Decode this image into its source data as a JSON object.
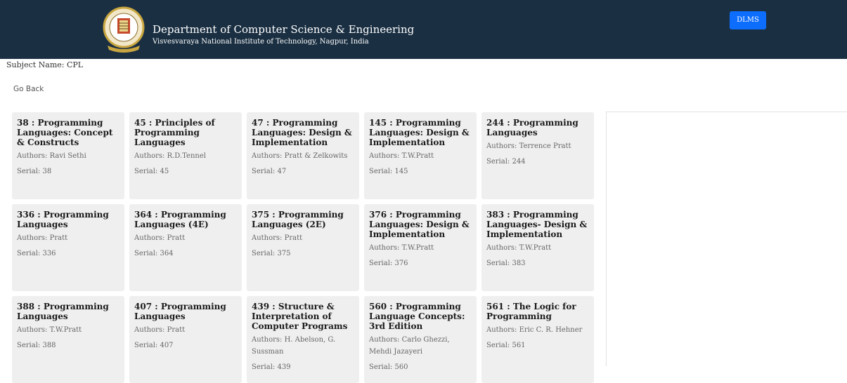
{
  "header": {
    "title": "Department of Computer Science & Engineering",
    "subtitle": "Visvesvaraya National Institute of Technology, Nagpur, India",
    "dlms_label": "DLMS",
    "logo_icon": "institute-emblem-icon"
  },
  "subject": {
    "label": "Subject Name: CPL"
  },
  "nav": {
    "go_back": "Go Back"
  },
  "books": [
    {
      "title": "38 : Programming Languages: Concept & Constructs",
      "authors": "Authors: Ravi Sethi",
      "serial": "Serial: 38"
    },
    {
      "title": "45 : Principles of Programming Languages",
      "authors": "Authors: R.D.Tennel",
      "serial": "Serial: 45"
    },
    {
      "title": "47 : Programming Languages: Design & Implementation",
      "authors": "Authors: Pratt & Zelkowits",
      "serial": "Serial: 47"
    },
    {
      "title": "145 : Programming Languages: Design & Implementation",
      "authors": "Authors: T.W.Pratt",
      "serial": "Serial: 145"
    },
    {
      "title": "244 : Programming Languages",
      "authors": "Authors: Terrence Pratt",
      "serial": "Serial: 244"
    },
    {
      "title": "336 : Programming Languages",
      "authors": "Authors: Pratt",
      "serial": "Serial: 336"
    },
    {
      "title": "364 : Programming Languages (4E)",
      "authors": "Authors: Pratt",
      "serial": "Serial: 364"
    },
    {
      "title": "375 : Programming Languages (2E)",
      "authors": "Authors: Pratt",
      "serial": "Serial: 375"
    },
    {
      "title": "376 : Programming Languages: Design & Implementation",
      "authors": "Authors: T.W.Pratt",
      "serial": "Serial: 376"
    },
    {
      "title": "383 : Programming Languages- Design & Implementation",
      "authors": "Authors: T.W.Pratt",
      "serial": "Serial: 383"
    },
    {
      "title": "388 : Programming Languages",
      "authors": "Authors: T.W.Pratt",
      "serial": "Serial: 388"
    },
    {
      "title": "407 : Programming Languages",
      "authors": "Authors: Pratt",
      "serial": "Serial: 407"
    },
    {
      "title": "439 : Structure & Interpretation of Computer Programs",
      "authors": "Authors: H. Abelson, G. Sussman",
      "serial": "Serial: 439"
    },
    {
      "title": "560 : Programming Language Concepts: 3rd Edition",
      "authors": "Authors: Carlo Ghezzi, Mehdi Jazayeri",
      "serial": "Serial: 560"
    },
    {
      "title": "561 : The Logic for Programming",
      "authors": "Authors: Eric C. R. Hehner",
      "serial": "Serial: 561"
    }
  ],
  "colors": {
    "header_bg": "#1a2f42",
    "button_bg": "#0d6efd",
    "card_bg": "#efefef"
  }
}
